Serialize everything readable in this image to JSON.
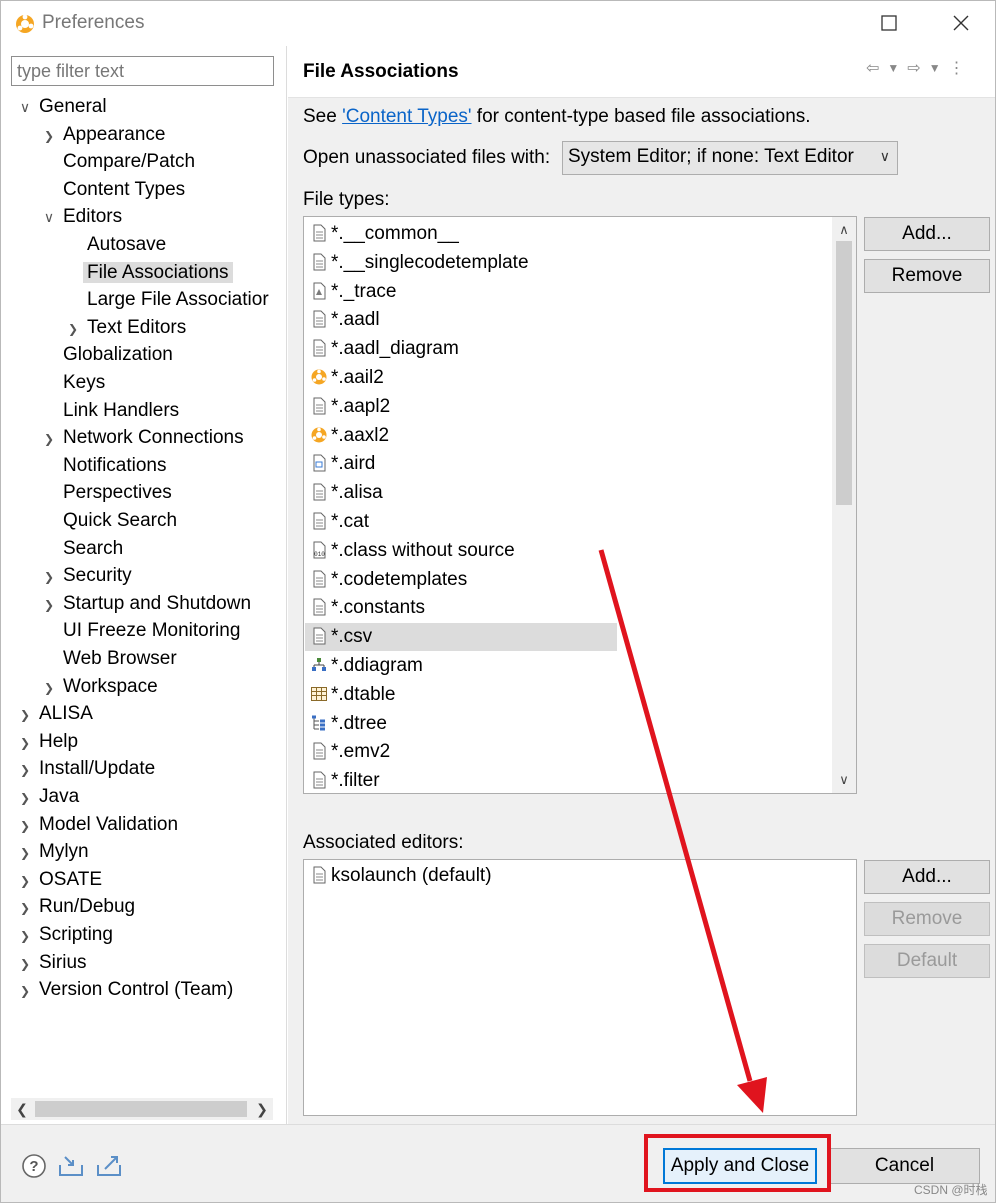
{
  "window": {
    "title": "Preferences",
    "maximize_icon": "maximize-icon",
    "close_icon": "close-icon"
  },
  "sidebar": {
    "filter_placeholder": "type filter text",
    "items": [
      {
        "label": "General",
        "twisty": "expanded"
      },
      {
        "label": "Appearance",
        "twisty": "collapsed"
      },
      {
        "label": "Compare/Patch",
        "twisty": "none"
      },
      {
        "label": "Content Types",
        "twisty": "none"
      },
      {
        "label": "Editors",
        "twisty": "expanded"
      },
      {
        "label": "Autosave",
        "twisty": "none"
      },
      {
        "label": "File Associations",
        "twisty": "none",
        "selected": true
      },
      {
        "label": "Large File Associatior",
        "twisty": "none"
      },
      {
        "label": "Text Editors",
        "twisty": "collapsed"
      },
      {
        "label": "Globalization",
        "twisty": "none"
      },
      {
        "label": "Keys",
        "twisty": "none"
      },
      {
        "label": "Link Handlers",
        "twisty": "none"
      },
      {
        "label": "Network Connections",
        "twisty": "collapsed"
      },
      {
        "label": "Notifications",
        "twisty": "none"
      },
      {
        "label": "Perspectives",
        "twisty": "none"
      },
      {
        "label": "Quick Search",
        "twisty": "none"
      },
      {
        "label": "Search",
        "twisty": "none"
      },
      {
        "label": "Security",
        "twisty": "collapsed"
      },
      {
        "label": "Startup and Shutdown",
        "twisty": "collapsed"
      },
      {
        "label": "UI Freeze Monitoring",
        "twisty": "none"
      },
      {
        "label": "Web Browser",
        "twisty": "none"
      },
      {
        "label": "Workspace",
        "twisty": "collapsed"
      },
      {
        "label": "ALISA",
        "twisty": "collapsed"
      },
      {
        "label": "Help",
        "twisty": "collapsed"
      },
      {
        "label": "Install/Update",
        "twisty": "collapsed"
      },
      {
        "label": "Java",
        "twisty": "collapsed"
      },
      {
        "label": "Model Validation",
        "twisty": "collapsed"
      },
      {
        "label": "Mylyn",
        "twisty": "collapsed"
      },
      {
        "label": "OSATE",
        "twisty": "collapsed"
      },
      {
        "label": "Run/Debug",
        "twisty": "collapsed"
      },
      {
        "label": "Scripting",
        "twisty": "collapsed"
      },
      {
        "label": "Sirius",
        "twisty": "collapsed"
      },
      {
        "label": "Version Control (Team)",
        "twisty": "collapsed"
      }
    ]
  },
  "page": {
    "title": "File Associations",
    "see_prefix": "See ",
    "content_types_link": "'Content Types'",
    "see_suffix": " for content-type based file associations.",
    "open_unassociated_label": "Open unassociated files with:",
    "open_unassociated_value": "System Editor; if none: Text Editor",
    "file_types_label": "File types:",
    "file_types": [
      {
        "name": "*.__common__",
        "icon": "text-file-icon"
      },
      {
        "name": "*.__singlecodetemplate",
        "icon": "text-file-icon"
      },
      {
        "name": "*._trace",
        "icon": "trace-file-icon"
      },
      {
        "name": "*.aadl",
        "icon": "text-file-icon"
      },
      {
        "name": "*.aadl_diagram",
        "icon": "text-file-icon"
      },
      {
        "name": "*.aail2",
        "icon": "osate-icon"
      },
      {
        "name": "*.aapl2",
        "icon": "text-file-icon"
      },
      {
        "name": "*.aaxl2",
        "icon": "osate-icon"
      },
      {
        "name": "*.aird",
        "icon": "aird-file-icon"
      },
      {
        "name": "*.alisa",
        "icon": "text-file-icon"
      },
      {
        "name": "*.cat",
        "icon": "text-file-icon"
      },
      {
        "name": "*.class without source",
        "icon": "class-file-icon"
      },
      {
        "name": "*.codetemplates",
        "icon": "text-file-icon"
      },
      {
        "name": "*.constants",
        "icon": "text-file-icon"
      },
      {
        "name": "*.csv",
        "icon": "text-file-icon",
        "selected": true
      },
      {
        "name": "*.ddiagram",
        "icon": "diagram-file-icon"
      },
      {
        "name": "*.dtable",
        "icon": "table-file-icon"
      },
      {
        "name": "*.dtree",
        "icon": "tree-file-icon"
      },
      {
        "name": "*.emv2",
        "icon": "text-file-icon"
      },
      {
        "name": "*.filter",
        "icon": "text-file-icon"
      }
    ],
    "file_types_add": "Add...",
    "file_types_remove": "Remove",
    "associated_editors_label": "Associated editors:",
    "associated_editors": [
      {
        "name": "ksolaunch (default)",
        "icon": "text-file-icon"
      }
    ],
    "editors_add": "Add...",
    "editors_remove": "Remove",
    "editors_default": "Default"
  },
  "footer": {
    "help_icon": "help-icon",
    "import_icon": "import-icon",
    "export_icon": "export-icon",
    "apply_close": "Apply and Close",
    "cancel": "Cancel"
  },
  "annotation": {
    "color": "#e0141e"
  },
  "watermark": "CSDN @时栈"
}
